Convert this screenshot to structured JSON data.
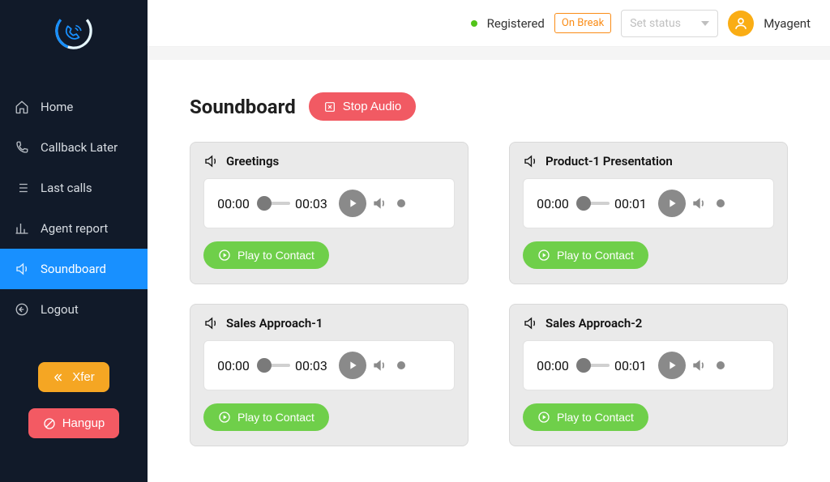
{
  "header": {
    "registered_label": "Registered",
    "break_badge": "On Break",
    "status_placeholder": "Set status",
    "username": "Myagent"
  },
  "sidebar": {
    "items": [
      {
        "label": "Home",
        "icon": "home"
      },
      {
        "label": "Callback Later",
        "icon": "phone"
      },
      {
        "label": "Last calls",
        "icon": "list"
      },
      {
        "label": "Agent report",
        "icon": "bars"
      },
      {
        "label": "Soundboard",
        "icon": "speaker",
        "active": true
      },
      {
        "label": "Logout",
        "icon": "logout"
      }
    ],
    "xfer_label": "Xfer",
    "hangup_label": "Hangup"
  },
  "page": {
    "title": "Soundboard",
    "stop_audio_label": "Stop Audio",
    "play_to_contact_label": "Play to Contact"
  },
  "cards": [
    {
      "title": "Greetings",
      "time_start": "00:00",
      "time_end": "00:03"
    },
    {
      "title": "Product-1 Presentation",
      "time_start": "00:00",
      "time_end": "00:01"
    },
    {
      "title": "Sales Approach-1",
      "time_start": "00:00",
      "time_end": "00:03"
    },
    {
      "title": "Sales Approach-2",
      "time_start": "00:00",
      "time_end": "00:01"
    }
  ]
}
